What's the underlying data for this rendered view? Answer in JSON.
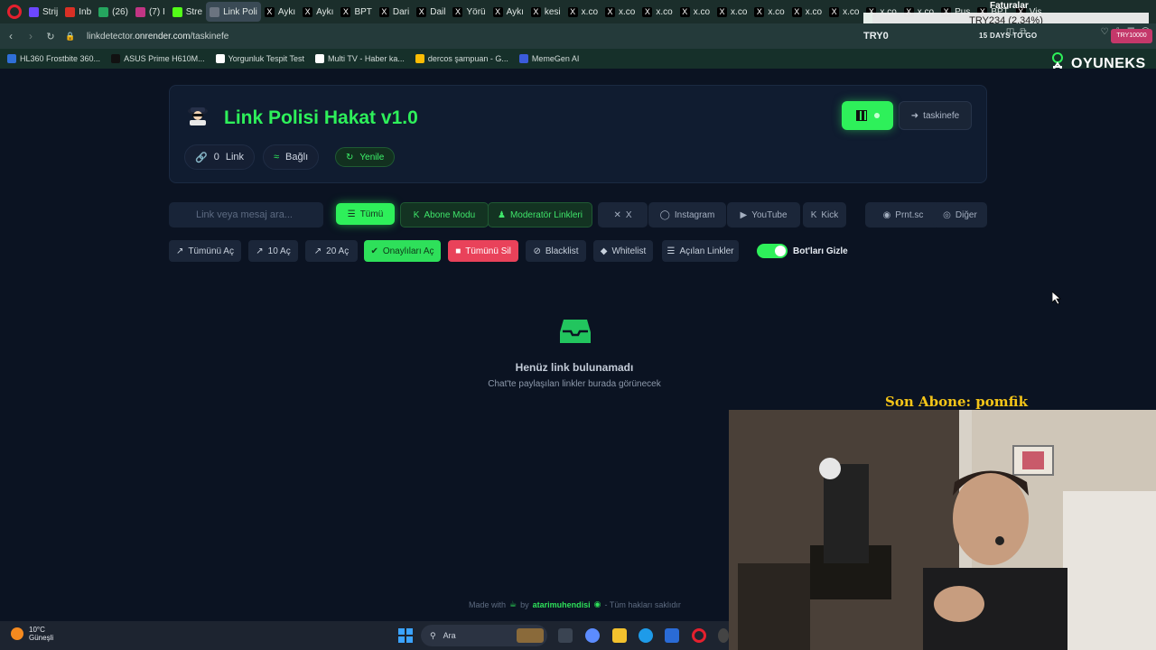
{
  "browser": {
    "tabs": [
      {
        "label": "Strij",
        "color": "#6c47ff"
      },
      {
        "label": "Inb",
        "color": "#d93025"
      },
      {
        "label": "(26)",
        "color": "#25a55f"
      },
      {
        "label": "(7) I",
        "color": "#c13584"
      },
      {
        "label": "Stre",
        "color": "#53fc18"
      },
      {
        "label": "Link Poli",
        "color": "#6b7480"
      },
      {
        "label": "Aykı",
        "color": "#000000"
      },
      {
        "label": "Aykı",
        "color": "#000000"
      },
      {
        "label": "BPT",
        "color": "#000000"
      },
      {
        "label": "Dari",
        "color": "#000000"
      },
      {
        "label": "Dail",
        "color": "#000000"
      },
      {
        "label": "Yörü",
        "color": "#000000"
      },
      {
        "label": "Aykı",
        "color": "#000000"
      },
      {
        "label": "kesi",
        "color": "#000000"
      },
      {
        "label": "x.co",
        "color": "#000000"
      },
      {
        "label": "x.co",
        "color": "#000000"
      },
      {
        "label": "x.co",
        "color": "#000000"
      },
      {
        "label": "x.co",
        "color": "#000000"
      },
      {
        "label": "x.co",
        "color": "#000000"
      },
      {
        "label": "x.co",
        "color": "#000000"
      },
      {
        "label": "x.co",
        "color": "#000000"
      },
      {
        "label": "x.co",
        "color": "#000000"
      },
      {
        "label": "x.co",
        "color": "#000000"
      },
      {
        "label": "x.co",
        "color": "#000000"
      },
      {
        "label": "Pus",
        "color": "#000000"
      },
      {
        "label": "BPT",
        "color": "#000000"
      },
      {
        "label": "Vis",
        "color": "#000000"
      }
    ],
    "url_prefix": "linkdetector.",
    "url_host": "onrender.com",
    "url_path": "/taskinefe",
    "bookmarks": [
      {
        "label": "HL360 Frostbite 360...",
        "color": "#2f6fd8"
      },
      {
        "label": "ASUS Prime H610M...",
        "color": "#111111"
      },
      {
        "label": "Yorgunluk Tespit Test",
        "color": "#ffffff"
      },
      {
        "label": "Multi TV - Haber ka...",
        "color": "#ffffff"
      },
      {
        "label": "dercos şampuan - G...",
        "color": "#fbbc05"
      },
      {
        "label": "MemeGen AI",
        "color": "#3b5bdb"
      }
    ]
  },
  "overlay": {
    "faturalar": "Faturalar",
    "ticker": "TRY234 (2.34%)",
    "try_left": "TRY0",
    "days_to_go": "15 DAYS TO GO",
    "try_right": "TRY10000",
    "brand": "OYUNEKS",
    "last_sub": "Son Abone: pomfik"
  },
  "app": {
    "title": "Link Polisi Hakat v1.0",
    "user": "taskinefe",
    "link_count": "0",
    "link_label": "Link",
    "connection": "Bağlı",
    "refresh": "Yenile",
    "search_placeholder": "Link veya mesaj ara...",
    "filters": [
      {
        "label": "Tümü",
        "icon": "list-icon"
      },
      {
        "label": "Abone Modu",
        "icon": "kick-icon"
      },
      {
        "label": "Moderatör Linkleri",
        "icon": "user-icon"
      },
      {
        "label": "X",
        "icon": "x-icon"
      },
      {
        "label": "Instagram",
        "icon": "instagram-icon"
      },
      {
        "label": "YouTube",
        "icon": "youtube-icon"
      },
      {
        "label": "Kick",
        "icon": "kick-icon"
      },
      {
        "label": "Prnt.sc",
        "icon": "camera-icon"
      },
      {
        "label": "Diğer",
        "icon": "globe-icon"
      }
    ],
    "actions": [
      {
        "label": "Tümünü Aç",
        "icon": "external-link-icon"
      },
      {
        "label": "10 Aç",
        "icon": "external-link-icon"
      },
      {
        "label": "20 Aç",
        "icon": "external-link-icon"
      },
      {
        "label": "Onaylıları Aç",
        "icon": "check-circle-icon"
      },
      {
        "label": "Tümünü Sil",
        "icon": "trash-icon"
      },
      {
        "label": "Blacklist",
        "icon": "ban-icon"
      },
      {
        "label": "Whitelist",
        "icon": "shield-icon"
      },
      {
        "label": "Açılan Linkler",
        "icon": "list-icon"
      }
    ],
    "toggle_label": "Bot'ları Gizle",
    "toggle_on": true,
    "empty_title": "Henüz link bulunamadı",
    "empty_sub": "Chat'te paylaşılan linkler burada görünecek",
    "footer_made": "Made with",
    "footer_by": "by",
    "footer_author": "atarimuhendisi",
    "footer_rights": "- Tüm hakları saklıdır"
  },
  "taskbar": {
    "temp": "10°C",
    "weather": "Güneşli",
    "search": "Ara"
  }
}
